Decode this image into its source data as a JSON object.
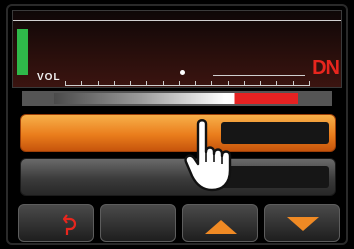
{
  "display": {
    "vol_label": "VOL",
    "direction_label": "DN",
    "colors": {
      "signal": "#2fb94a",
      "direction": "#e8261e"
    }
  },
  "volume_bar": {
    "level": 0.74
  },
  "buttons": {
    "primary": {
      "style": "orange",
      "value": ""
    },
    "secondary": {
      "style": "gray",
      "value": ""
    }
  },
  "softkeys": [
    {
      "name": "back",
      "icon": "undo-arrow-icon"
    },
    {
      "name": "blank",
      "icon": ""
    },
    {
      "name": "up",
      "icon": "arrow-up-icon"
    },
    {
      "name": "down",
      "icon": "arrow-down-icon"
    }
  ],
  "accent_color": "#f08a24",
  "overlay": {
    "icon": "pointing-hand-icon"
  }
}
